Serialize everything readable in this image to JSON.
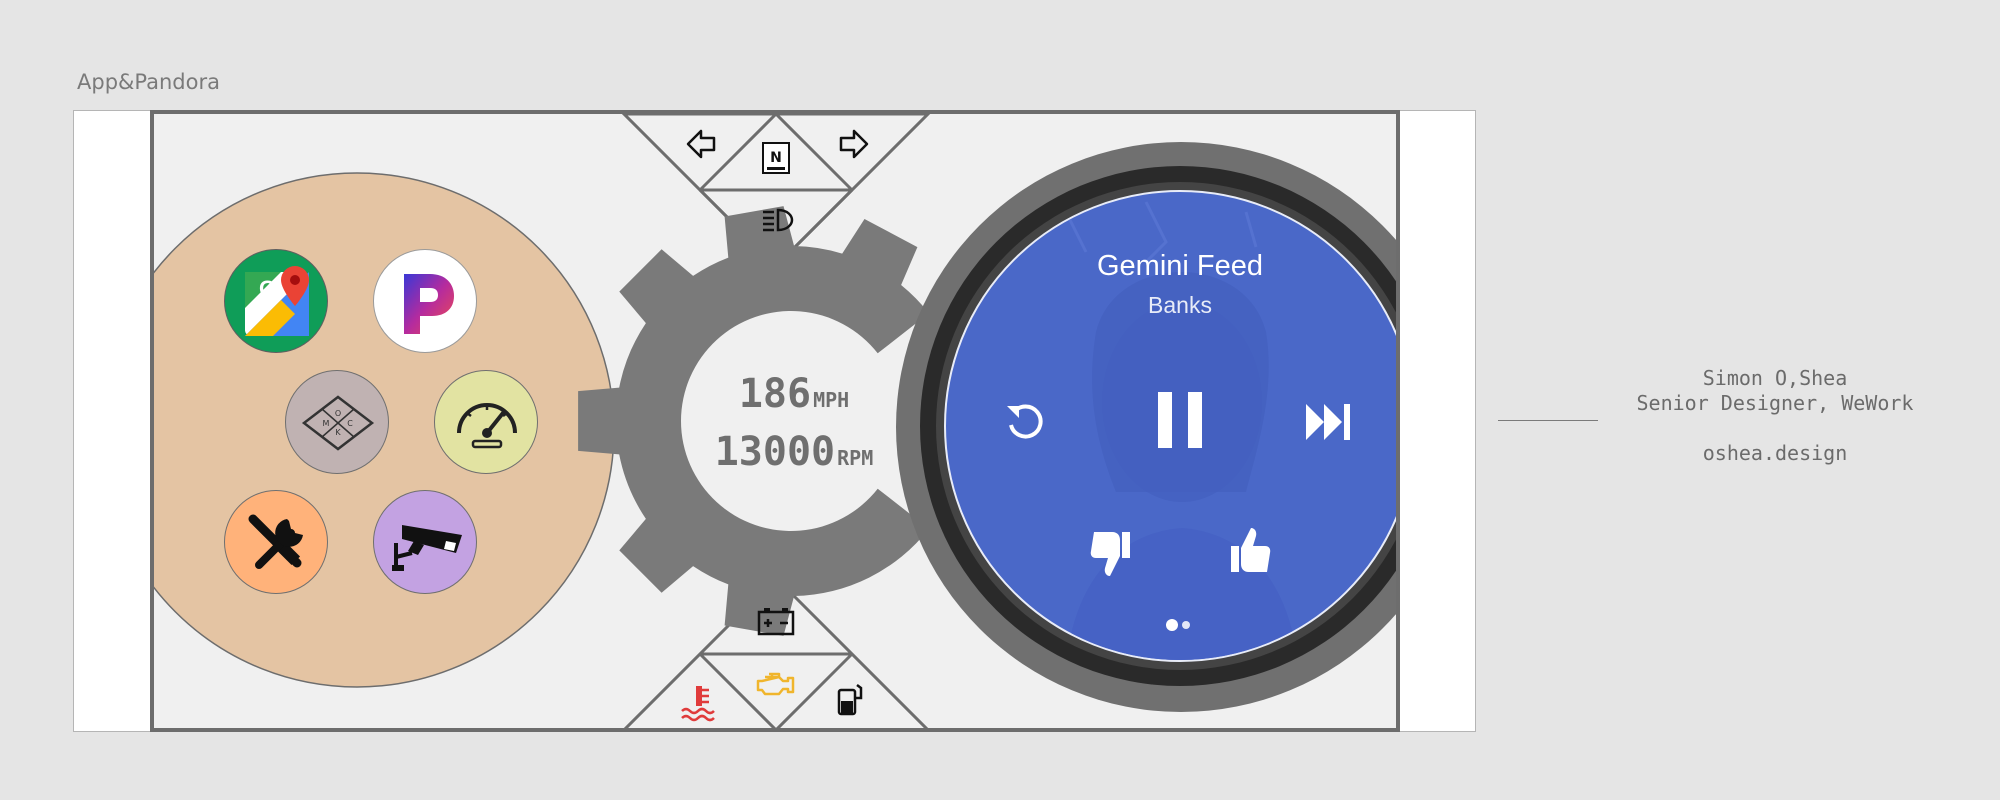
{
  "frame_title": "App&Pandora",
  "apps": [
    {
      "name": "google-maps",
      "label": "Google Maps"
    },
    {
      "name": "pandora",
      "label": "Pandora"
    },
    {
      "name": "mock-badge",
      "label": "MOCK"
    },
    {
      "name": "speedometer",
      "label": "Speedometer"
    },
    {
      "name": "tools",
      "label": "Tools"
    },
    {
      "name": "security-camera",
      "label": "Security Camera"
    }
  ],
  "mock_badge_letters": {
    "m": "M",
    "o": "O",
    "c": "C",
    "k": "K"
  },
  "gear_button": {
    "label": "N"
  },
  "gauge": {
    "speed_value": "186",
    "speed_unit": "MPH",
    "rpm_value": "13000",
    "rpm_unit": "RPM"
  },
  "player": {
    "track_title": "Gemini Feed",
    "track_artist": "Banks",
    "page_count": 2,
    "active_page": 1
  },
  "credits": {
    "name": "Simon O,Shea",
    "role": "Senior Designer, WeWork",
    "site": "oshea.design"
  },
  "colors": {
    "background": "#e5e5e5",
    "screen": "#f0f0f0",
    "app_panel": "#e4c4a3",
    "gear": "#7a7a7a",
    "player_disc": "#4a68c8",
    "coolant_warning": "#e03b3b",
    "engine_warning": "#f0b52c",
    "maps_green": "#0f9d58",
    "tools_orange": "#ffb27a",
    "camera_purple": "#c3a2e2",
    "speedo_yellow": "#e2e3a2",
    "mock_grey": "#c0b2b2"
  },
  "icons": {
    "turn_left": "arrow-left-icon",
    "turn_right": "arrow-right-icon",
    "headlight": "headlight-icon",
    "battery": "battery-icon",
    "engine": "check-engine-icon",
    "coolant": "coolant-temp-icon",
    "fuel": "fuel-pump-icon",
    "replay": "replay-icon",
    "pause": "pause-icon",
    "skip": "skip-forward-icon",
    "thumb_down": "thumb-down-icon",
    "thumb_up": "thumb-up-icon"
  }
}
